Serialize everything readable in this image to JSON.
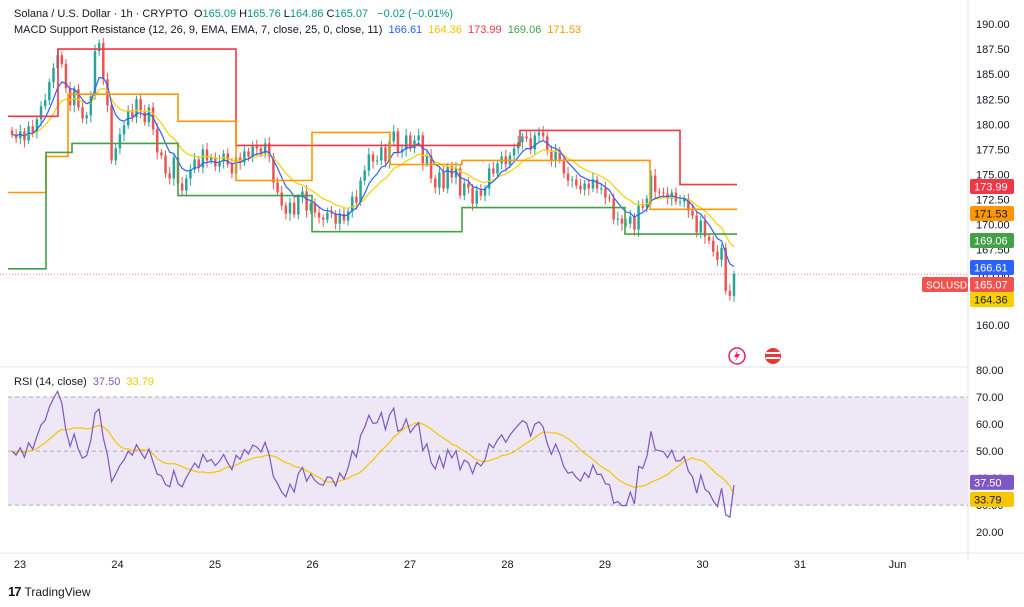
{
  "header": {
    "symbol_title": "Solana / U.S. Dollar · 1h · CRYPTO",
    "ohlc": [
      {
        "k": "O",
        "v": "165.09"
      },
      {
        "k": "H",
        "v": "165.76"
      },
      {
        "k": "L",
        "v": "164.86"
      },
      {
        "k": "C",
        "v": "165.07"
      }
    ],
    "change": "−0.02 (−0.01%)",
    "indicator_name": "MACD Support Resistance (12, 26, 9, EMA, EMA, 7, close, 25, 0, close, 11)",
    "indicator_values": [
      "166.61",
      "164.36",
      "173.99",
      "169.06",
      "171.53"
    ],
    "rsi_name": "RSI (14, close)",
    "rsi_values": [
      "37.50",
      "33.79"
    ]
  },
  "colors": {
    "up": "#26a69a",
    "down": "#ef5350",
    "ema_fast": "#2962ff",
    "ema_slow": "#f7d000",
    "resistance": "#f23645",
    "mid": "#ff9800",
    "support": "#43a047",
    "rsi": "#7e57c2",
    "rsi_ma": "#f7c600",
    "rsi_band": "#ede7f6"
  },
  "footer": {
    "brand": "TradingView"
  },
  "chart_data": [
    {
      "type": "candlestick",
      "symbol": "SOLUSD",
      "x_ticks": [
        "23",
        "24",
        "25",
        "26",
        "27",
        "28",
        "29",
        "30",
        "31",
        "Jun"
      ],
      "y_ticks": [
        "190.00",
        "187.50",
        "185.00",
        "182.50",
        "180.00",
        "177.50",
        "175.00",
        "172.50",
        "170.00",
        "167.50",
        "165.00",
        "162.50",
        "160.00"
      ],
      "ylim": [
        158.5,
        191
      ],
      "close_series": [
        179,
        178.6,
        179.3,
        178.4,
        179.8,
        179.2,
        180.5,
        181.8,
        182.4,
        184.2,
        185.6,
        186.9,
        186,
        183.6,
        181.9,
        183.5,
        181.7,
        180.6,
        180.9,
        182.8,
        187.3,
        188.1,
        184.5,
        181.9,
        176.4,
        177.6,
        179,
        179.9,
        181.4,
        180.7,
        182.5,
        181.3,
        180.2,
        181.7,
        179.5,
        177.2,
        176.9,
        175.1,
        174.6,
        176.7,
        174.1,
        173.4,
        174.6,
        175.5,
        176.5,
        175.7,
        177.5,
        176.4,
        176.7,
        175.8,
        176.3,
        177.1,
        176,
        175.1,
        176.7,
        176.2,
        177.3,
        176.8,
        177.8,
        177.6,
        177.1,
        178.1,
        176.8,
        174.2,
        173.2,
        171.9,
        171.1,
        172.2,
        171,
        172.7,
        173.3,
        171.4,
        172.1,
        171.2,
        170.7,
        170.5,
        171.2,
        171.1,
        170.1,
        171.1,
        170.4,
        171.3,
        172.8,
        172.2,
        174.4,
        175.4,
        177,
        176.3,
        176.4,
        177.7,
        176.3,
        178.3,
        179.3,
        177.2,
        177.5,
        178.9,
        177.6,
        178.4,
        178.9,
        176.1,
        176.9,
        174.6,
        173.7,
        175.2,
        173.6,
        175.8,
        174.7,
        175.6,
        172.9,
        174.1,
        173.7,
        172.1,
        173.4,
        172.9,
        173.6,
        175.6,
        175.1,
        176.1,
        176.8,
        176,
        176.9,
        177.6,
        178.2,
        178.8,
        178.6,
        177.5,
        178.9,
        179.2,
        178.8,
        177.4,
        176.4,
        177.4,
        176.5,
        175.1,
        174.4,
        174.5,
        173.9,
        173.5,
        174.1,
        173.6,
        174.5,
        173.6,
        173.6,
        172.7,
        172.6,
        170.5,
        170.6,
        170.1,
        170.1,
        170.8,
        169.5,
        171.9,
        171.7,
        172.6,
        174.9,
        173.3,
        173.2,
        173.1,
        172.6,
        173.2,
        172.3,
        172.3,
        172.6,
        171.4,
        170.9,
        169.2,
        170.4,
        168.8,
        168.4,
        167.3,
        166.5,
        167.7,
        163.4,
        162.9,
        165.07
      ],
      "overlays": [
        {
          "name": "EMA fast",
          "last": 166.61
        },
        {
          "name": "EMA slow",
          "last": 164.36
        },
        {
          "name": "Resistance",
          "last": 173.99
        },
        {
          "name": "Mid",
          "last": 171.53
        },
        {
          "name": "Support",
          "last": 169.06
        }
      ],
      "price_label": {
        "name": "SOLUSD",
        "value": "165.07"
      },
      "axis_badges": [
        "173.99",
        "171.53",
        "169.06",
        "166.61",
        "165.07",
        "164.36"
      ]
    },
    {
      "type": "line",
      "name": "RSI (14, close)",
      "y_ticks": [
        "80.00",
        "70.00",
        "60.00",
        "50.00",
        "40.00",
        "30.00",
        "20.00"
      ],
      "ylim": [
        16,
        80
      ],
      "band": [
        30,
        70
      ],
      "series": [
        {
          "name": "RSI",
          "last": 37.5
        },
        {
          "name": "RSI MA",
          "last": 33.79
        }
      ],
      "axis_badges": [
        "37.50",
        "33.79"
      ]
    }
  ]
}
